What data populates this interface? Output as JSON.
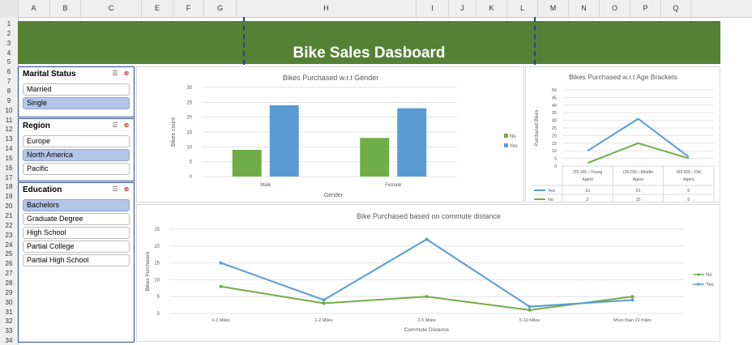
{
  "spreadsheet": {
    "columns": [
      "A",
      "B",
      "C",
      "E",
      "F",
      "G",
      "H",
      "I",
      "J",
      "K",
      "L",
      "M",
      "N",
      "O",
      "P",
      "Q"
    ],
    "rows": [
      "1",
      "2",
      "3",
      "4",
      "5",
      "6",
      "7",
      "8",
      "9",
      "10",
      "11",
      "12",
      "13",
      "14",
      "15",
      "16",
      "17",
      "18",
      "19",
      "20",
      "21",
      "22",
      "23",
      "24",
      "25",
      "26",
      "27",
      "28",
      "29",
      "30",
      "31",
      "32",
      "33",
      "34"
    ]
  },
  "dashboard": {
    "title": "Bike Sales Dasboard",
    "banner_color": "#548235"
  },
  "slicers": {
    "marital": {
      "title": "Marital Status",
      "items": [
        {
          "label": "Married",
          "selected": false
        },
        {
          "label": "Single",
          "selected": true
        }
      ]
    },
    "region": {
      "title": "Region",
      "items": [
        {
          "label": "Europe",
          "selected": false
        },
        {
          "label": "North America",
          "selected": true
        },
        {
          "label": "Pacific",
          "selected": false
        }
      ]
    },
    "education": {
      "title": "Education",
      "items": [
        {
          "label": "Bachelors",
          "selected": true
        },
        {
          "label": "Graduate Degree",
          "selected": false
        },
        {
          "label": "High School",
          "selected": false
        },
        {
          "label": "Partial College",
          "selected": false
        },
        {
          "label": "Partial High School",
          "selected": false
        }
      ]
    },
    "multiselect_icon": "multi-select-icon",
    "clear_filter_icon": "clear-filter-icon"
  },
  "chart_data": [
    {
      "type": "bar",
      "title": "Bikes Purchased w.r.t Gender",
      "xlabel": "Gender",
      "ylabel": "Bikes count",
      "categories": [
        "Male",
        "Female"
      ],
      "series": [
        {
          "name": "No",
          "values": [
            9,
            13
          ],
          "color": "#70ad47"
        },
        {
          "name": "Yes",
          "values": [
            24,
            23
          ],
          "color": "#5b9bd5"
        }
      ],
      "ylim": [
        0,
        30
      ],
      "yticks": [
        0,
        5,
        10,
        15,
        20,
        25,
        30
      ],
      "legend": "right"
    },
    {
      "type": "line",
      "title": "Bikes Purchased w.r.t Age Brackets",
      "ylabel": "Purchased Bikes",
      "categories": [
        "(25-34)---Young Agers",
        "(35-59)---Middle Agers",
        "(60-89)---Old Agers"
      ],
      "series": [
        {
          "name": "Yes",
          "values": [
            10,
            31,
            6
          ],
          "color": "#5b9bd5"
        },
        {
          "name": "No",
          "values": [
            2,
            15,
            5
          ],
          "color": "#70ad47"
        }
      ],
      "ylim": [
        0,
        50
      ],
      "yticks": [
        0,
        5,
        10,
        15,
        20,
        25,
        30,
        35,
        40,
        45,
        50
      ],
      "legend": "data-table"
    },
    {
      "type": "line",
      "title": "Bike Purchased based on commute distance",
      "xlabel": "Commute Distance",
      "ylabel": "Bikes Purchased",
      "categories": [
        "0-1 Miles",
        "1-2 Miles",
        "2-5 Miles",
        "5-10 Miles",
        "More than 10 miles"
      ],
      "series": [
        {
          "name": "No",
          "values": [
            8,
            3,
            5,
            1,
            5
          ],
          "color": "#70ad47"
        },
        {
          "name": "Yes",
          "values": [
            15,
            4,
            22,
            2,
            4
          ],
          "color": "#5b9bd5"
        }
      ],
      "ylim": [
        0,
        25
      ],
      "yticks": [
        0,
        5,
        10,
        15,
        20,
        25
      ],
      "legend": "right"
    }
  ]
}
